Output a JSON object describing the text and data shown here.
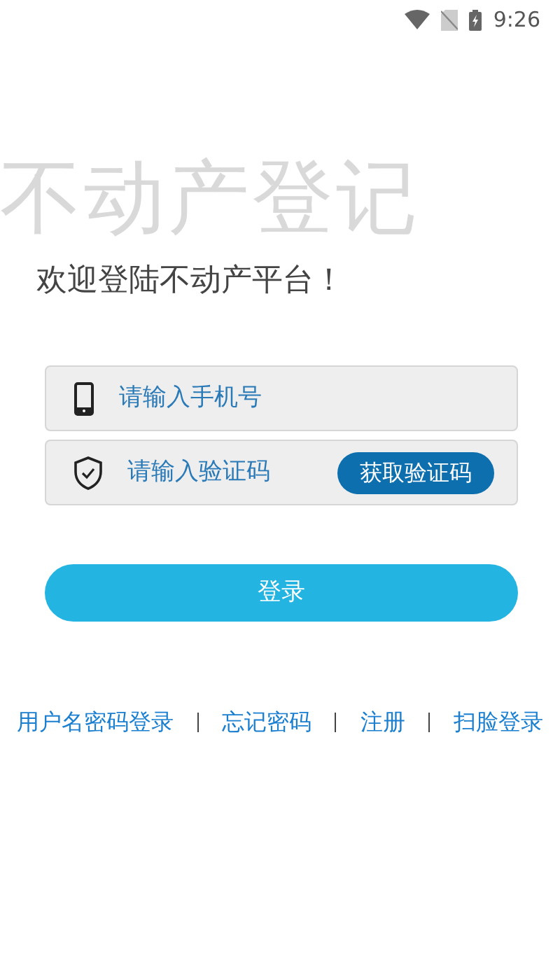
{
  "status_bar": {
    "time": "9:26"
  },
  "background_title": "不动产登记",
  "welcome": "欢迎登陆不动产平台！",
  "fields": [
    {
      "kind": "phone",
      "placeholder": "请输入手机号"
    },
    {
      "kind": "code",
      "placeholder": "请输入验证码",
      "button": "获取验证码"
    }
  ],
  "login_button": "登录",
  "links": [
    "用户名密码登录",
    "忘记密码",
    "注册",
    "扫脸登录"
  ]
}
